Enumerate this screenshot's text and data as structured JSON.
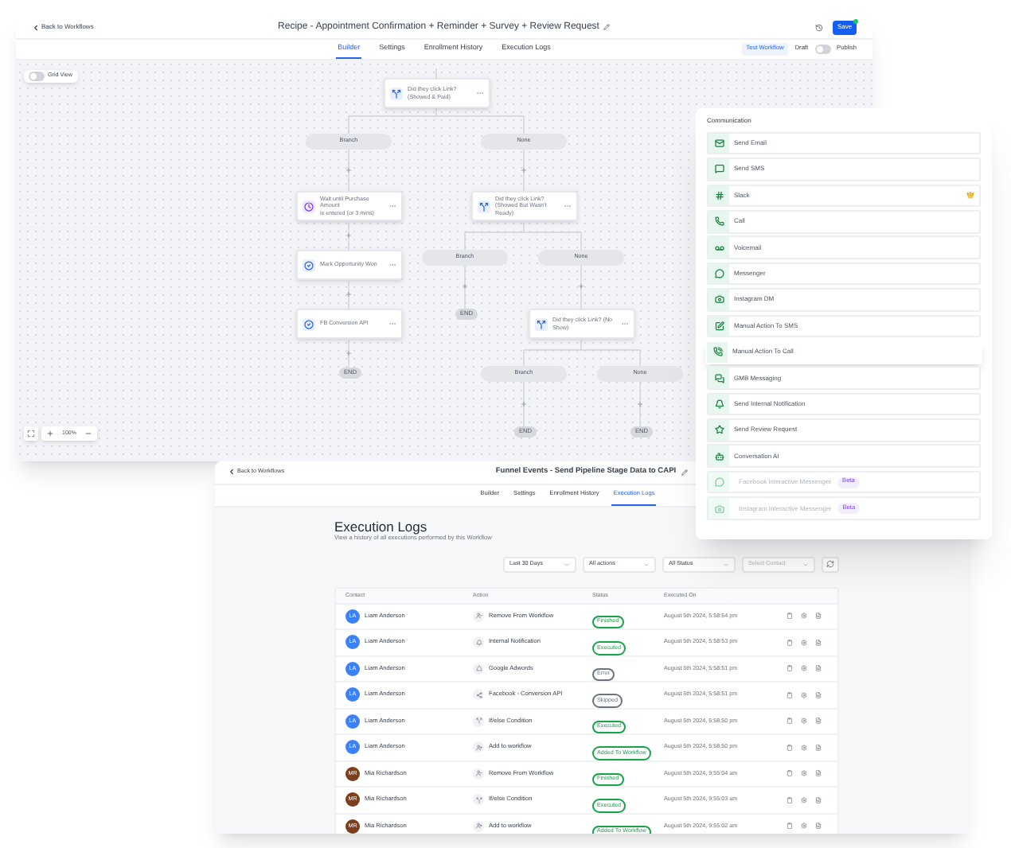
{
  "builder_window": {
    "back_link": "Back to Workflows",
    "title": "Recipe - Appointment Confirmation + Reminder + Survey + Review Request",
    "save_button": "Save",
    "unsaved": true,
    "tabs": [
      {
        "label": "Builder",
        "selected": true
      },
      {
        "label": "Settings",
        "selected": false
      },
      {
        "label": "Enrollment History",
        "selected": false
      },
      {
        "label": "Execution Logs",
        "selected": false
      }
    ],
    "test_button": "Test Workflow",
    "draft_label": "Draft",
    "publish_toggle": {
      "on": false
    },
    "publish_label": "Publish",
    "grid_view": {
      "label": "Grid View",
      "on": false
    },
    "zoom_level": "100%",
    "nodes": [
      {
        "kind": "condition",
        "title": "Did they click Link?",
        "subtitle": "(Showed & Paid)"
      },
      {
        "kind": "wait",
        "title": "Wait until Purchase Amount",
        "subtitle": "is entered (or 3 mins)"
      },
      {
        "kind": "condition",
        "title": "Did they click Link?",
        "subtitle": "(Showed But Wasn't Ready)"
      },
      {
        "kind": "action",
        "title": "Mark Opportunity Won"
      },
      {
        "kind": "action",
        "title": "FB Conversion API"
      },
      {
        "kind": "condition",
        "title": "Did they click Link? (No Show)"
      }
    ],
    "branches": [
      {
        "label": "Branch"
      },
      {
        "label": "None"
      },
      {
        "label": "Branch"
      },
      {
        "label": "None"
      },
      {
        "label": "Branch"
      },
      {
        "label": "None"
      }
    ],
    "ends": [
      {
        "label": "END"
      },
      {
        "label": "END"
      },
      {
        "label": "END"
      },
      {
        "label": "END"
      }
    ]
  },
  "communication_panel": {
    "title": "Communication",
    "items": [
      {
        "label": "Send Email",
        "premium": false,
        "highlighted": false,
        "disabled": false
      },
      {
        "label": "Send SMS",
        "premium": false,
        "highlighted": false,
        "disabled": false
      },
      {
        "label": "Slack",
        "premium": true,
        "highlighted": false,
        "disabled": false
      },
      {
        "label": "Call",
        "premium": false,
        "highlighted": false,
        "disabled": false
      },
      {
        "label": "Voicemail",
        "premium": false,
        "highlighted": false,
        "disabled": false
      },
      {
        "label": "Messenger",
        "premium": false,
        "highlighted": false,
        "disabled": false
      },
      {
        "label": "Instagram DM",
        "premium": false,
        "highlighted": false,
        "disabled": false
      },
      {
        "label": "Manual Action To SMS",
        "premium": false,
        "highlighted": false,
        "disabled": false
      },
      {
        "label": "Manual Action To Call",
        "premium": false,
        "highlighted": true,
        "disabled": false
      },
      {
        "label": "GMB Messaging",
        "premium": false,
        "highlighted": false,
        "disabled": false
      },
      {
        "label": "Send Internal Notification",
        "premium": false,
        "highlighted": false,
        "disabled": false
      },
      {
        "label": "Send Review Request",
        "premium": false,
        "highlighted": false,
        "disabled": false
      },
      {
        "label": "Conversation AI",
        "premium": false,
        "highlighted": false,
        "disabled": false
      },
      {
        "label": "Facebook Interactive Messenger",
        "badge": "Beta",
        "premium": false,
        "highlighted": false,
        "disabled": true
      },
      {
        "label": "Instagram Interactive Messenger",
        "badge": "Beta",
        "premium": false,
        "highlighted": false,
        "disabled": true
      }
    ]
  },
  "logs_window": {
    "back_link": "Back to Workflows",
    "title": "Funnel Events - Send Pipeline Stage Data to CAPI",
    "tabs": [
      {
        "label": "Builder",
        "selected": false
      },
      {
        "label": "Settings",
        "selected": false
      },
      {
        "label": "Enrollment History",
        "selected": false
      },
      {
        "label": "Execution Logs",
        "selected": true
      }
    ],
    "heading": "Execution Logs",
    "subheading": "View a history of all executions performed by this Workflow",
    "filters": [
      {
        "value": "Last 30 Days"
      },
      {
        "value": "All actions"
      },
      {
        "value": "All Status"
      },
      {
        "placeholder": "Select Contact"
      }
    ],
    "table": {
      "columns": [
        "Contact",
        "Action",
        "Status",
        "Executed On"
      ],
      "rows": [
        {
          "initials": "LA",
          "name": "Liam Anderson",
          "color": "#3b82f6",
          "action": "Remove From Workflow",
          "status": {
            "label": "Finished",
            "color": "#16a34a"
          },
          "executed_on": "August 5th 2024, 5:58:54 pm"
        },
        {
          "initials": "LA",
          "name": "Liam Anderson",
          "color": "#3b82f6",
          "action": "Internal Notification",
          "status": {
            "label": "Executed",
            "color": "#16a34a"
          },
          "executed_on": "August 5th 2024, 5:58:53 pm"
        },
        {
          "initials": "LA",
          "name": "Liam Anderson",
          "color": "#3b82f6",
          "action": "Google Adwords",
          "status": {
            "label": "Error",
            "color": "#6b7280"
          },
          "executed_on": "August 5th 2024, 5:58:51 pm"
        },
        {
          "initials": "LA",
          "name": "Liam Anderson",
          "color": "#3b82f6",
          "action": "Facebook - Conversion API",
          "status": {
            "label": "Skipped",
            "color": "#6b7280"
          },
          "executed_on": "August 5th 2024, 5:58:51 pm"
        },
        {
          "initials": "LA",
          "name": "Liam Anderson",
          "color": "#3b82f6",
          "action": "If/else Condition",
          "status": {
            "label": "Executed",
            "color": "#16a34a"
          },
          "executed_on": "August 5th 2024, 5:58:50 pm"
        },
        {
          "initials": "LA",
          "name": "Liam Anderson",
          "color": "#3b82f6",
          "action": "Add to workflow",
          "status": {
            "label": "Added To Workflow",
            "color": "#16a34a"
          },
          "executed_on": "August 5th 2024, 5:58:50 pm"
        },
        {
          "initials": "MR",
          "name": "Mia Richardson",
          "color": "#7c3f1d",
          "action": "Remove From Workflow",
          "status": {
            "label": "Finished",
            "color": "#16a34a"
          },
          "executed_on": "August 5th 2024, 9:55:04 am"
        },
        {
          "initials": "MR",
          "name": "Mia Richardson",
          "color": "#7c3f1d",
          "action": "If/else Condition",
          "status": {
            "label": "Executed",
            "color": "#16a34a"
          },
          "executed_on": "August 5th 2024, 9:55:03 am"
        },
        {
          "initials": "MR",
          "name": "Mia Richardson",
          "color": "#7c3f1d",
          "action": "Add to workflow",
          "status": {
            "label": "Added To Workflow",
            "color": "#16a34a"
          },
          "executed_on": "August 5th 2024, 9:55:02 am"
        }
      ]
    }
  }
}
